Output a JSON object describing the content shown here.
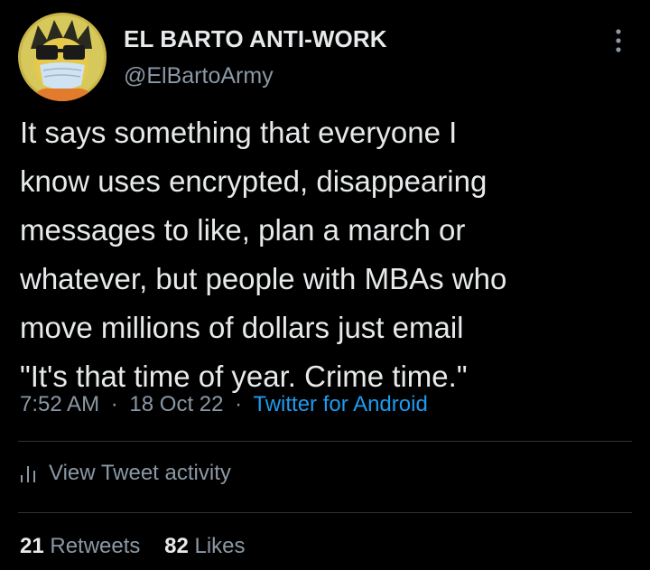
{
  "tweet": {
    "author": {
      "display_name": "EL BARTO ANTI-WORK",
      "handle": "@ElBartoArmy"
    },
    "text": "It says something that everyone I\nknow uses encrypted, disappearing\nmessages to like, plan a march or\nwhatever, but people with MBAs who\nmove millions of dollars just email\n\"It's that time of year. Crime time.\"",
    "time": "7:52 AM",
    "date": "18 Oct 22",
    "separator": "·",
    "source": "Twitter for Android",
    "activity_label": "View Tweet activity",
    "stats": {
      "retweets": {
        "count": "21",
        "label": "Retweets"
      },
      "likes": {
        "count": "82",
        "label": "Likes"
      }
    }
  },
  "icons": {
    "more": "more-vertical-icon",
    "activity": "bar-chart-icon"
  },
  "colors": {
    "background": "#000000",
    "text_primary": "#e7e9ea",
    "text_secondary": "#8b98a5",
    "link": "#1d9bf0",
    "divider": "#2f3336"
  }
}
